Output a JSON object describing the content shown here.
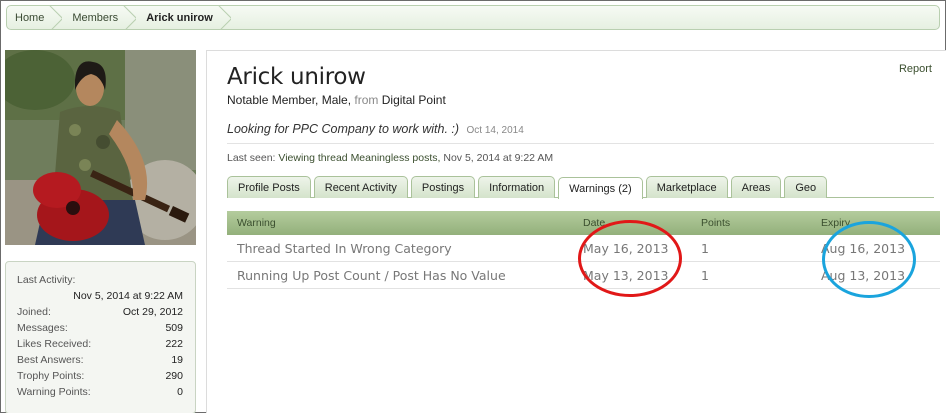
{
  "breadcrumb": [
    "Home",
    "Members",
    "Arick unirow"
  ],
  "sidebar": {
    "stats": [
      {
        "label": "Last Activity:",
        "value": ""
      },
      {
        "label": "",
        "value": "Nov 5, 2014 at 9:22 AM"
      },
      {
        "label": "Joined:",
        "value": "Oct 29, 2012"
      },
      {
        "label": "Messages:",
        "value": "509"
      },
      {
        "label": "Likes Received:",
        "value": "222"
      },
      {
        "label": "Best Answers:",
        "value": "19"
      },
      {
        "label": "Trophy Points:",
        "value": "290"
      },
      {
        "label": "Warning Points:",
        "value": "0"
      }
    ]
  },
  "profile": {
    "report": "Report",
    "name": "Arick unirow",
    "title_prefix": "Notable Member, Male,",
    "from_word": "from",
    "location": "Digital Point",
    "status": "Looking for PPC Company to work with. :)",
    "status_date": "Oct 14, 2014",
    "last_seen_label": "Last seen:",
    "last_seen_activity": "Viewing thread Meaningless posts,",
    "last_seen_time": "Nov 5, 2014 at 9:22 AM"
  },
  "tabs": [
    "Profile Posts",
    "Recent Activity",
    "Postings",
    "Information",
    "Warnings (2)",
    "Marketplace",
    "Areas",
    "Geo"
  ],
  "active_tab": "Warnings (2)",
  "warnings": {
    "headers": [
      "Warning",
      "Date",
      "Points",
      "Expiry"
    ],
    "rows": [
      {
        "warning": "Thread Started In Wrong Category",
        "date": "May 16, 2013",
        "points": "1",
        "expiry": "Aug 16, 2013"
      },
      {
        "warning": "Running Up Post Count / Post Has No Value",
        "date": "May 13, 2013",
        "points": "1",
        "expiry": "Aug 13, 2013"
      }
    ]
  },
  "colors": {
    "accent_green": "#93b07b",
    "annotation_red": "#e11818",
    "annotation_blue": "#1aa4dd"
  }
}
